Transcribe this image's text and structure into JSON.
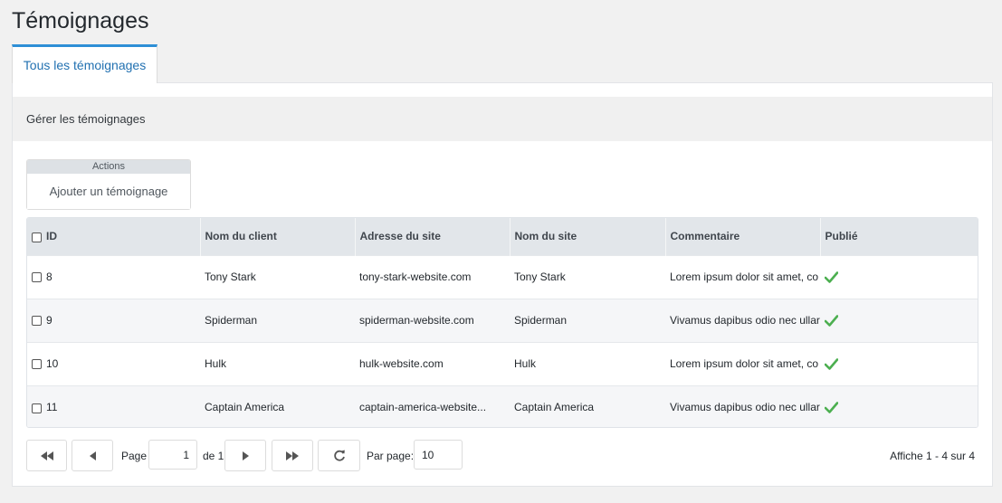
{
  "page": {
    "title": "Témoignages"
  },
  "tabs": [
    {
      "label": "Tous les témoignages",
      "active": true
    }
  ],
  "panel": {
    "header": "Gérer les témoignages"
  },
  "actions": {
    "title": "Actions",
    "add_label": "Ajouter un témoignage"
  },
  "grid": {
    "columns": [
      "ID",
      "Nom du client",
      "Adresse du site",
      "Nom du site",
      "Commentaire",
      "Publié"
    ],
    "rows": [
      {
        "id": "8",
        "client": "Tony Stark",
        "url": "tony-stark-website.com",
        "site": "Tony Stark",
        "comment": "Lorem ipsum dolor sit amet, co",
        "published": true
      },
      {
        "id": "9",
        "client": "Spiderman",
        "url": "spiderman-website.com",
        "site": "Spiderman",
        "comment": "Vivamus dapibus odio nec ullar",
        "published": true
      },
      {
        "id": "10",
        "client": "Hulk",
        "url": "hulk-website.com",
        "site": "Hulk",
        "comment": "Lorem ipsum dolor sit amet, co",
        "published": true
      },
      {
        "id": "11",
        "client": "Captain America",
        "url": "captain-america-website...",
        "site": "Captain America",
        "comment": "Vivamus dapibus odio nec ullar",
        "published": true
      }
    ]
  },
  "pager": {
    "page_label": "Page",
    "page_value": "1",
    "of_label": "de 1",
    "per_page_label": "Par page:",
    "per_page_value": "10",
    "summary": "Affiche 1 - 4 sur 4"
  },
  "icons": {
    "first": "double-left-icon",
    "prev": "triangle-left-icon",
    "next": "triangle-right-icon",
    "last": "double-right-icon",
    "refresh": "refresh-icon",
    "published": "checkmark-icon"
  },
  "colors": {
    "accent": "#2e8fd6",
    "check": "#4caf50"
  }
}
